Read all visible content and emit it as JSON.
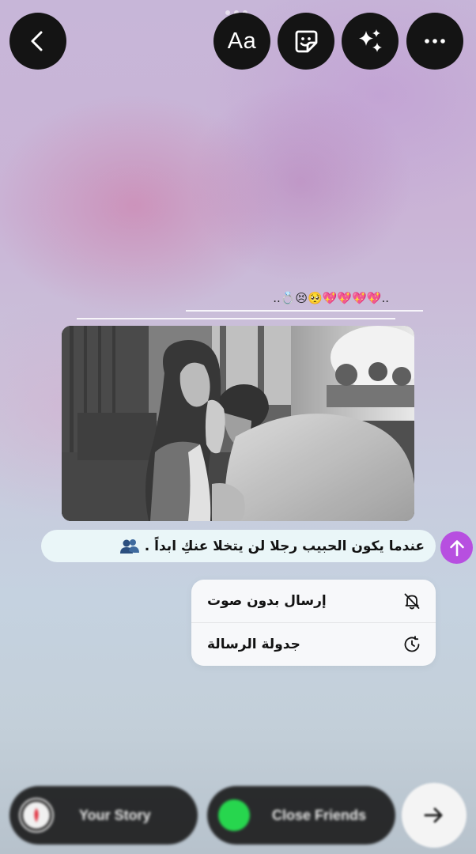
{
  "top_bar": {
    "back_icon": "chevron-left-icon",
    "text_tool_label": "Aa",
    "sticker_icon": "sticker-icon",
    "effects_icon": "sparkles-icon",
    "more_icon": "more-horizontal-icon"
  },
  "content": {
    "decoration_text": "..💖💖💖💖🥺😣💍..",
    "photo_description_icon": "photo",
    "message_text": "عندما يكون الحبيب رجلا لن يتخلا عنكِ ابداً .",
    "message_emoji": "people-icon",
    "send_icon": "arrow-up-icon"
  },
  "context_menu": {
    "items": [
      {
        "label": "إرسال بدون صوت",
        "icon": "bell-off-icon"
      },
      {
        "label": "جدولة الرسالة",
        "icon": "clock-icon"
      }
    ]
  },
  "bottom_bar": {
    "your_story_label": "Your Story",
    "close_friends_label": "Close Friends",
    "next_icon": "arrow-right-icon"
  },
  "colors": {
    "send_button": "#b74fe0",
    "close_friends": "#27d64e",
    "menu_background": "#f7f8fa",
    "bubble_background": "#eaf6f8"
  }
}
